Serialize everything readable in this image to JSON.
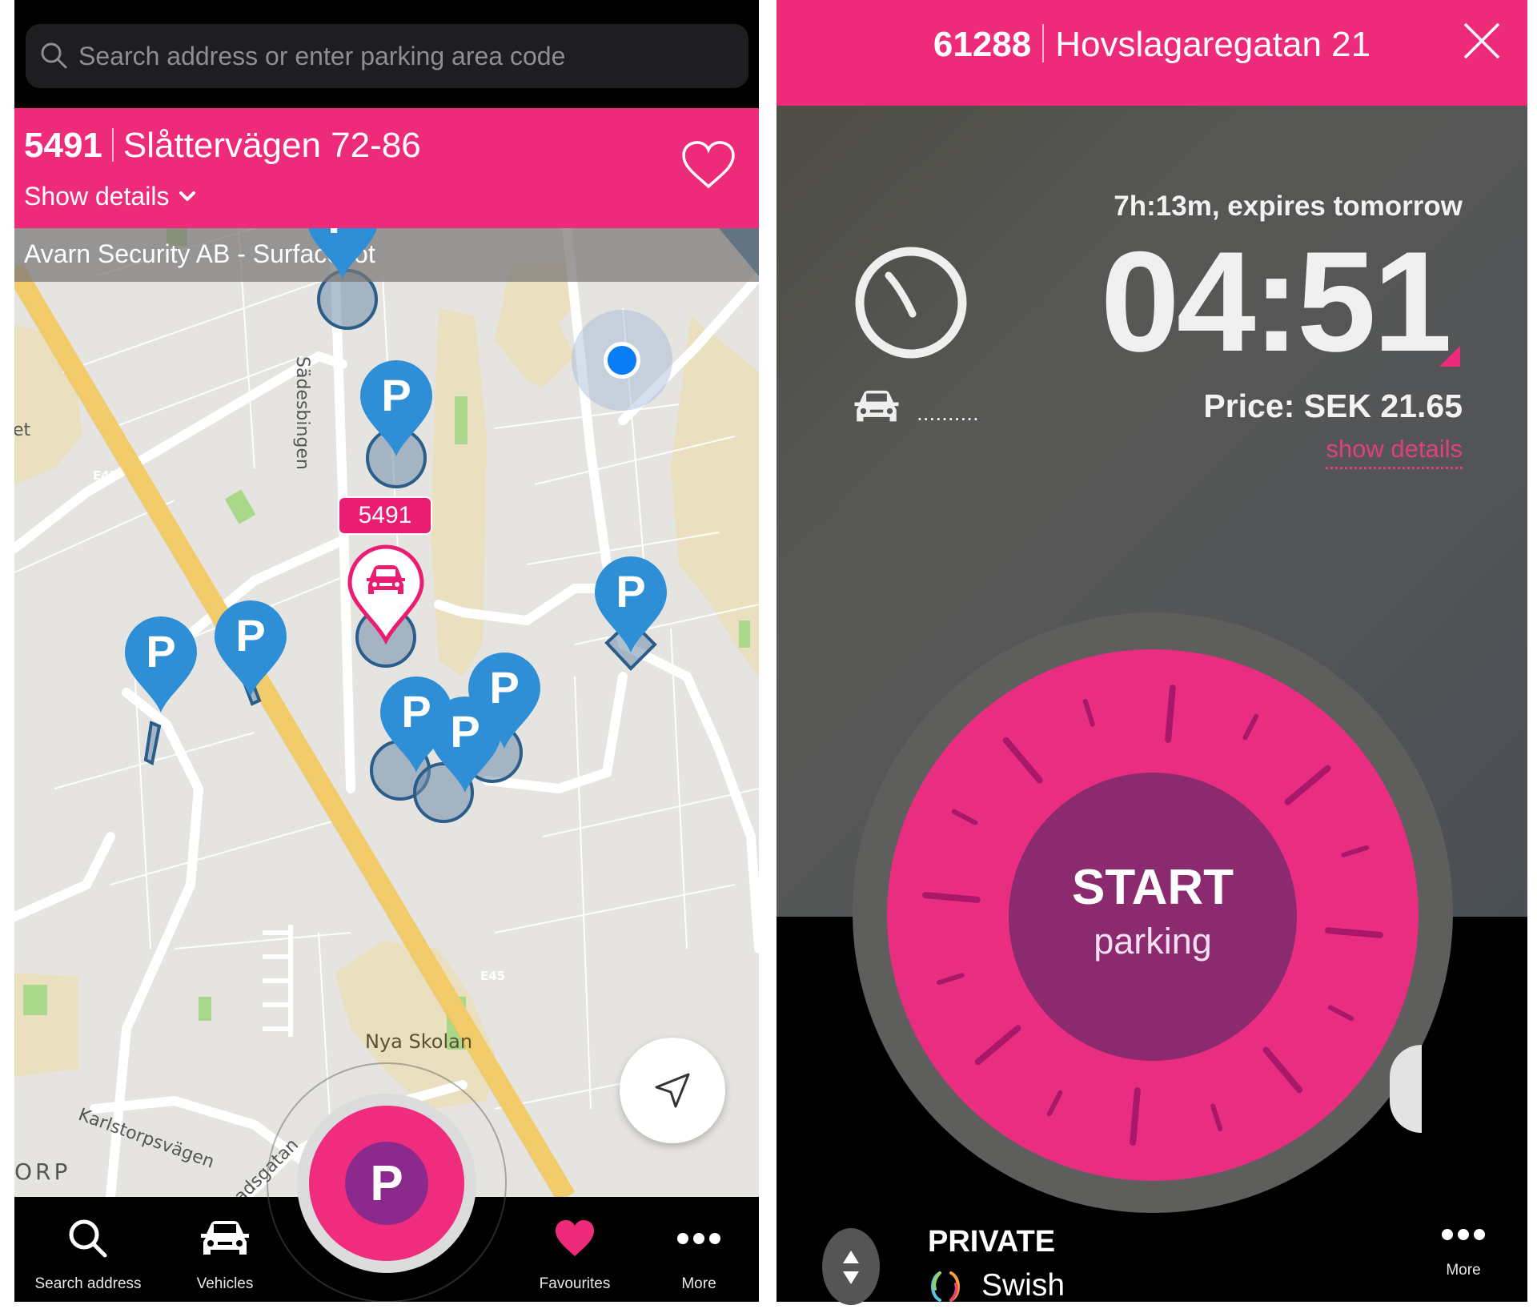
{
  "colors": {
    "brand_pink": "#ee2a7b",
    "brand_purple": "#8b2a8c",
    "pin_blue": "#2f8fd6",
    "highway_yellow": "#f2cc6a",
    "location_blue": "#0a7cf5"
  },
  "left_screen": {
    "search": {
      "icon": "search-icon",
      "placeholder": "Search address or enter parking area code",
      "value": ""
    },
    "header": {
      "area_code": "5491",
      "address": "Slåttervägen 72-86",
      "show_details_label": "Show details",
      "show_details_icon": "chevron-down-icon",
      "favourite_icon": "heart-outline-icon"
    },
    "operator_label": "Avarn Security AB - Surface lot",
    "map": {
      "selected_badge": "5491",
      "labels": {
        "street_1": "Sädesbingen",
        "street_2": "Karlstorpsvägen",
        "street_3": "adsgatan",
        "highway_1": "E45",
        "highway_2": "E45",
        "place_1": "Nya Skolan",
        "district": "ORP",
        "edge": "et"
      },
      "parking_pin_letter": "P",
      "locate_icon": "navigation-arrow-icon"
    },
    "fab_letter": "P",
    "nav": [
      {
        "label": "Search address",
        "icon": "search-icon"
      },
      {
        "label": "Vehicles",
        "icon": "car-icon"
      },
      {
        "label": "Favourites",
        "icon": "heart-icon"
      },
      {
        "label": "More",
        "icon": "more-dots-icon"
      }
    ]
  },
  "right_screen": {
    "header": {
      "area_code": "61288",
      "address": "Hovslagaregatan 21",
      "close_icon": "close-icon"
    },
    "expires_text": "7h:13m, expires tomorrow",
    "timer": "04:51",
    "vehicle_plate": "..........",
    "price": "Price: SEK 21.65",
    "show_details_label": "show details",
    "dial": {
      "title": "START",
      "subtitle": "parking"
    },
    "bottom": {
      "account_type": "PRIVATE",
      "payment_method": "Swish",
      "more_label": "More"
    }
  }
}
